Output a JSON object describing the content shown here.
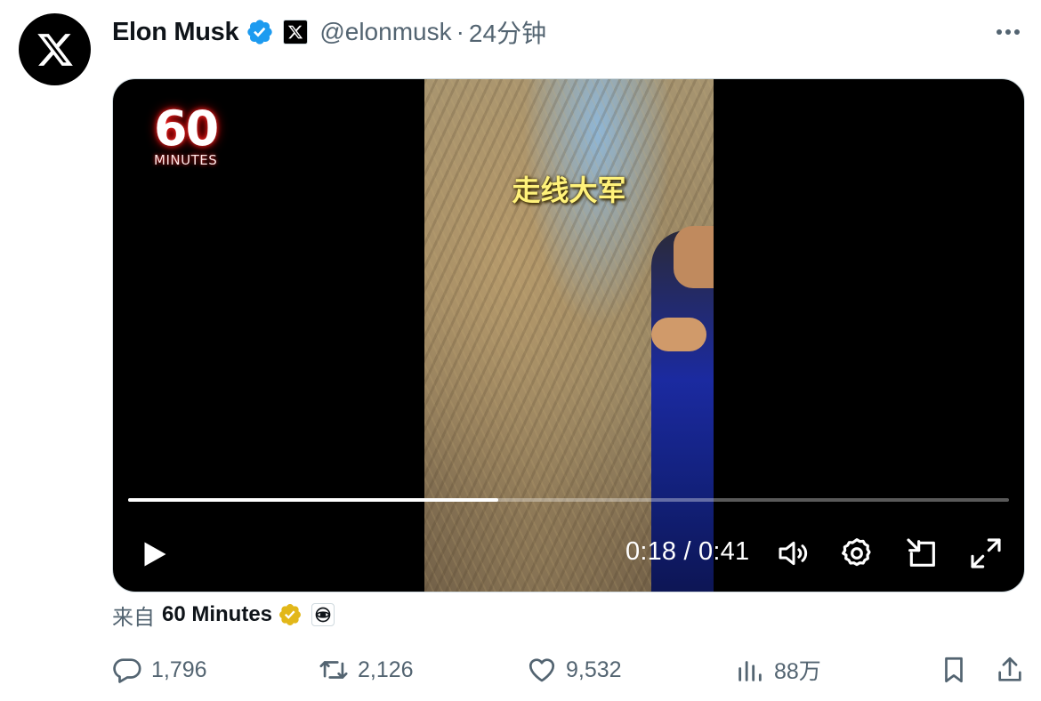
{
  "author": {
    "display_name": "Elon Musk",
    "handle": "@elonmusk",
    "separator": "·",
    "timestamp": "24分钟",
    "verified_badge": "blue-verified-icon",
    "affiliation_badge": "x-logo-icon",
    "avatar": "x-logo-icon"
  },
  "more_menu": {
    "icon": "more-horizontal-icon"
  },
  "media": {
    "logo_number": "60",
    "logo_text": "MINUTES",
    "subtitle": "走线大军",
    "current_time": "0:18",
    "time_separator": "/",
    "duration": "0:41",
    "progress_fraction": 0.42,
    "controls": [
      "play-icon",
      "volume-icon",
      "settings-icon",
      "picture-in-picture-icon",
      "fullscreen-icon"
    ]
  },
  "source": {
    "prefix": "来自",
    "name": "60 Minutes",
    "badge": "gold-verified-icon",
    "affiliation": "cbs-eye-icon"
  },
  "actions": {
    "replies": "1,796",
    "retweets": "2,126",
    "likes": "9,532",
    "views": "88万"
  },
  "colors": {
    "text_primary": "#0f1419",
    "text_secondary": "#536471",
    "verified_blue": "#1d9bf0",
    "verified_gold": "#e2b719",
    "border": "#cfd9de"
  }
}
